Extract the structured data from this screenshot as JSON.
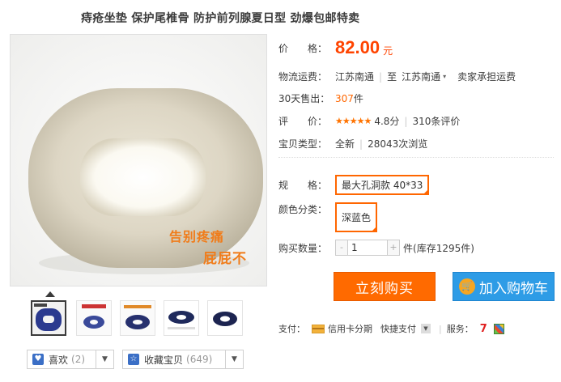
{
  "title": "痔疮坐垫 保护尾椎骨 防护前列腺夏日型 劲爆包邮特卖",
  "image_overlay": {
    "line1": "告别疼痛",
    "line2": "屁屁不"
  },
  "price": {
    "label": "价　　格：",
    "value": "82.00",
    "unit": "元"
  },
  "shipping": {
    "label": "物流运费：",
    "from": "江苏南通",
    "to_prefix": "至",
    "to": "江苏南通",
    "note": "卖家承担运费"
  },
  "sales": {
    "label": "30天售出：",
    "count": "307",
    "unit": "件"
  },
  "rating": {
    "label": "评　　价：",
    "stars": "★★★★★",
    "score": "4.8分",
    "reviews": "310条评价"
  },
  "type": {
    "label": "宝贝类型：",
    "condition": "全新",
    "views": "28043次浏览"
  },
  "spec": {
    "label": "规　　格：",
    "selected": "最大孔洞款 40*33"
  },
  "color": {
    "label": "颜色分类：",
    "selected": "深蓝色"
  },
  "quantity": {
    "label": "购买数量：",
    "value": "1",
    "unit": "件",
    "stock": "(库存1295件)"
  },
  "buttons": {
    "buy": "立刻购买",
    "cart": "加入购物车"
  },
  "payment": {
    "label": "支付：",
    "installment": "信用卡分期",
    "quick": "快捷支付",
    "service_label": "服务："
  },
  "actions": {
    "like": "喜欢",
    "like_count": "(2)",
    "fav": "收藏宝贝",
    "fav_count": "(649)"
  },
  "colors": {
    "accent": "#ff6600",
    "price": "#ff4400",
    "buy_button": "#ff6a00",
    "cart_button": "#2e9ce6"
  }
}
